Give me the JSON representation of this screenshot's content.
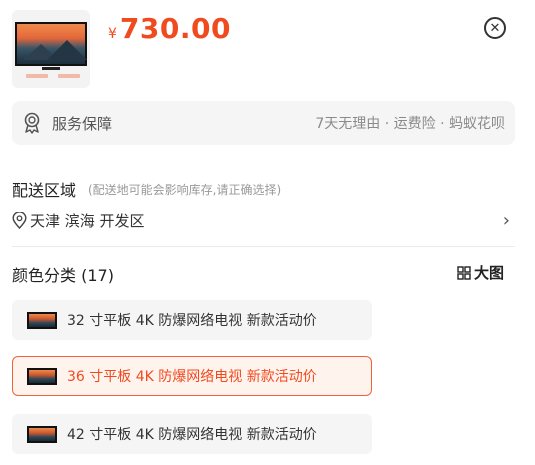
{
  "product": {
    "currency_symbol": "¥",
    "price": "730.00",
    "accent_color": "#f04b1f"
  },
  "service": {
    "label": "服务保障",
    "detail": "7天无理由 · 运费险 · 蚂蚁花呗",
    "icon": "award-badge-icon"
  },
  "delivery": {
    "title": "配送区域",
    "note": "(配送地可能会影响库存,请正确选择)",
    "location": "天津 滨海 开发区",
    "icon": "location-pin-icon"
  },
  "color_section": {
    "title": "颜色分类 (17)",
    "big_view_label": "大图",
    "options": [
      {
        "label": "32 寸平板 4K 防爆网络电视 新款活动价",
        "selected": false
      },
      {
        "label": "36 寸平板 4K 防爆网络电视 新款活动价",
        "selected": true
      },
      {
        "label": "42 寸平板 4K 防爆网络电视 新款活动价",
        "selected": false
      }
    ]
  }
}
